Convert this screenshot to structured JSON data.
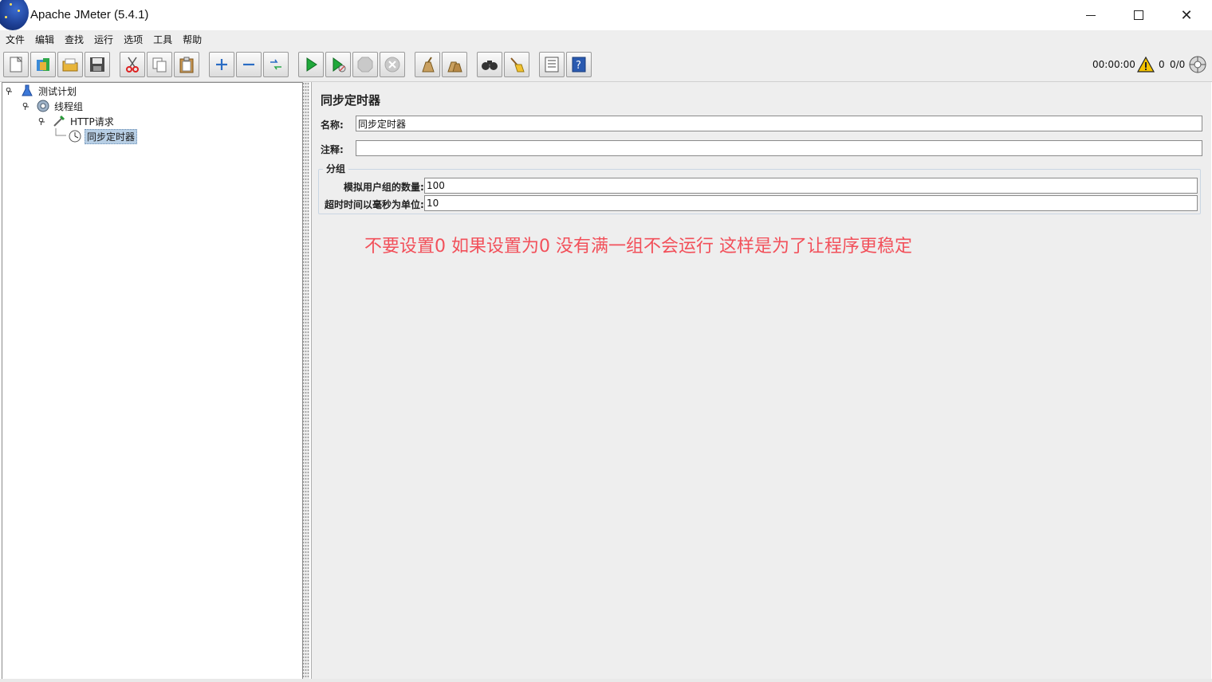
{
  "window": {
    "title": "Apache JMeter (5.4.1)",
    "minimize_icon": "minimize-icon",
    "maximize_icon": "maximize-icon",
    "close_glyph": "✕"
  },
  "menu": [
    "文件",
    "编辑",
    "查找",
    "运行",
    "选项",
    "工具",
    "帮助"
  ],
  "toolbar": {
    "buttons": [
      "new-icon",
      "templates-icon",
      "open-icon",
      "save-icon",
      "cut-icon",
      "copy-icon",
      "paste-icon",
      "expand-icon",
      "collapse-icon",
      "toggle-icon",
      "start-icon",
      "start-no-pause-icon",
      "stop-icon",
      "shutdown-icon",
      "clear-icon",
      "clear-all-icon",
      "search-icon",
      "reset-search-icon",
      "function-helper-icon",
      "help-icon"
    ]
  },
  "status": {
    "timer": "00:00:00",
    "warning_count": "0",
    "threads": "0/0"
  },
  "tree": {
    "plan": "测试计划",
    "thread_group": "线程组",
    "http_request": "HTTP请求",
    "timer": "同步定时器"
  },
  "panel": {
    "title": "同步定时器",
    "name_label": "名称:",
    "name_value": "同步定时器",
    "comment_label": "注释:",
    "comment_value": "",
    "group_title": "分组",
    "users_label": "模拟用户组的数量:",
    "users_value": "100",
    "timeout_label": "超时时间以毫秒为单位:",
    "timeout_value": "10"
  },
  "annotation": "不要设置0 如果设置为0 没有满一组不会运行 这样是为了让程序更稳定",
  "colors": {
    "annotation": "#f2505a",
    "selection": "#b8cfe5",
    "panel_bg": "#eeeeee"
  }
}
